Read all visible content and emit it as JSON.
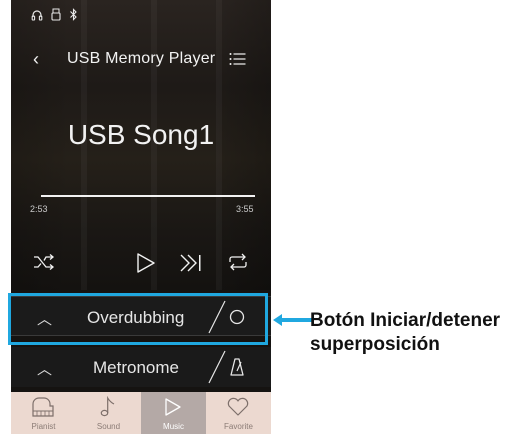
{
  "status_bar": {
    "icons": [
      "headphones-icon",
      "usb-icon",
      "bluetooth-icon"
    ]
  },
  "header": {
    "title": "USB Memory Player"
  },
  "player": {
    "song_title": "USB Song1",
    "time_elapsed": "2:53",
    "time_total": "3:55",
    "controls": [
      "shuffle-icon",
      "play-icon",
      "skip-forward-icon",
      "repeat-icon"
    ]
  },
  "overdubbing": {
    "label": "Overdubbing"
  },
  "metronome": {
    "label": "Metronome"
  },
  "tabs": [
    {
      "label": "Pianist",
      "icon": "piano-icon"
    },
    {
      "label": "Sound",
      "icon": "music-note-icon"
    },
    {
      "label": "Music",
      "icon": "play-icon"
    },
    {
      "label": "Favorite",
      "icon": "heart-icon"
    }
  ],
  "active_tab": "Music",
  "callout": {
    "line1": "Botón Iniciar/detener",
    "line2": "superposición"
  },
  "colors": {
    "highlight": "#20a8e0",
    "tabbar": "#ecd9d0",
    "tab_active": "#b4a9a6",
    "screen_bg": "#151311"
  }
}
